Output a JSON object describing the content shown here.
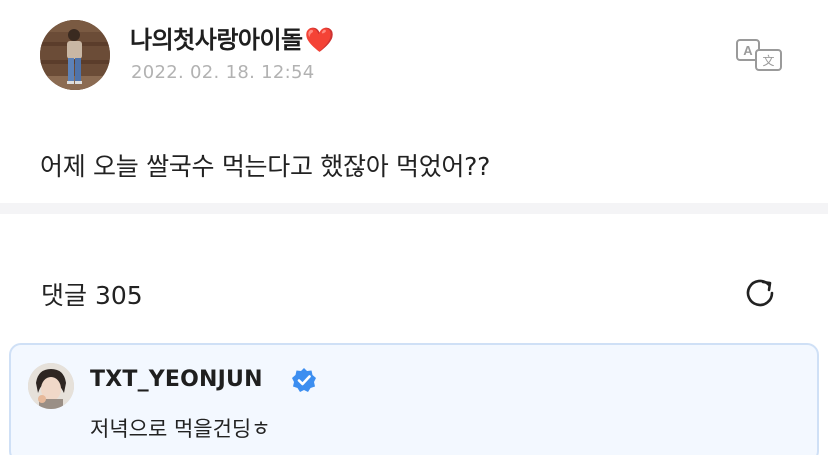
{
  "post": {
    "author": "나의첫사랑아이돌",
    "author_emoji": "❤️",
    "timestamp": "2022. 02. 18. 12:54",
    "body": "어제 오늘 쌀국수 먹는다고 했잖아 먹었어??",
    "translate_icon": "translate-icon"
  },
  "comments": {
    "title": "댓글 305",
    "refresh_icon": "refresh-icon",
    "items": [
      {
        "author": "TXT_YEONJUN",
        "verified": true,
        "text": "저녁으로 먹을건딩ㅎ"
      }
    ]
  },
  "colors": {
    "accent_blue": "#3c8ef0",
    "heart_red": "#e3202d",
    "highlight_bg": "#f3f8ff",
    "highlight_border": "#cfe0f6"
  }
}
